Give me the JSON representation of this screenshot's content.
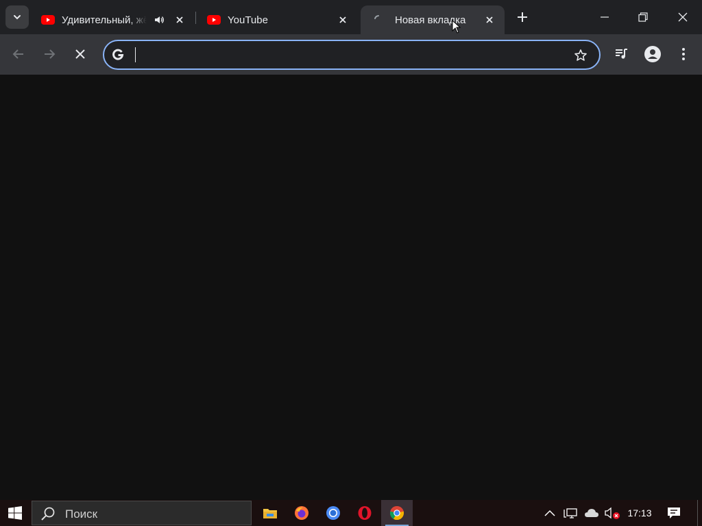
{
  "browser": {
    "tabs": [
      {
        "title": "Удивительный, жёлтый",
        "favicon": "youtube-icon",
        "audio": "speaker-icon",
        "active": false
      },
      {
        "title": "YouTube",
        "favicon": "youtube-icon",
        "active": false
      },
      {
        "title": "Новая вкладка",
        "favicon": "loading-spinner-icon",
        "active": true
      }
    ],
    "omnibox": {
      "value": "",
      "placeholder": ""
    },
    "accent_color": "#8ab4f8",
    "youtube_red": "#ff0000"
  },
  "taskbar": {
    "search_placeholder": "Поиск",
    "apps": [
      "file-explorer-icon",
      "firefox-icon",
      "chromium-icon",
      "opera-icon",
      "chrome-icon"
    ],
    "active_app": "chrome-icon",
    "clock": "17:13"
  }
}
